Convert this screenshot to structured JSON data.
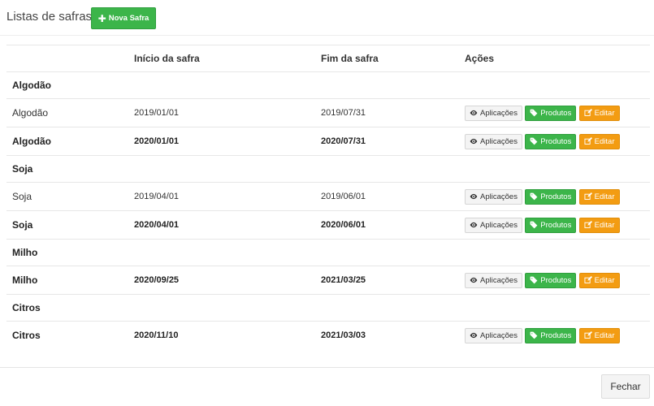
{
  "header": {
    "title": "Listas de safras",
    "new_button": "Nova Safra",
    "new_icon": "plus-icon"
  },
  "table": {
    "columns": [
      "",
      "Início da safra",
      "Fim da safra",
      "Ações"
    ],
    "actions": {
      "aplicacoes": "Aplicações",
      "produtos": "Produtos",
      "editar": "Editar"
    },
    "groups": [
      {
        "name": "Algodão",
        "items": [
          {
            "name": "Algodão",
            "start": "2019/01/01",
            "end": "2019/07/31",
            "bold": false
          },
          {
            "name": "Algodão",
            "start": "2020/01/01",
            "end": "2020/07/31",
            "bold": true
          }
        ]
      },
      {
        "name": "Soja",
        "items": [
          {
            "name": "Soja",
            "start": "2019/04/01",
            "end": "2019/06/01",
            "bold": false
          },
          {
            "name": "Soja",
            "start": "2020/04/01",
            "end": "2020/06/01",
            "bold": true
          }
        ]
      },
      {
        "name": "Milho",
        "items": [
          {
            "name": "Milho",
            "start": "2020/09/25",
            "end": "2021/03/25",
            "bold": true
          }
        ]
      },
      {
        "name": "Citros",
        "items": [
          {
            "name": "Citros",
            "start": "2020/11/10",
            "end": "2021/03/03",
            "bold": true
          }
        ]
      }
    ]
  },
  "footer": {
    "close_button": "Fechar"
  },
  "colors": {
    "green": "#3cb54a",
    "orange": "#f39c12",
    "gray": "#f4f4f4"
  }
}
